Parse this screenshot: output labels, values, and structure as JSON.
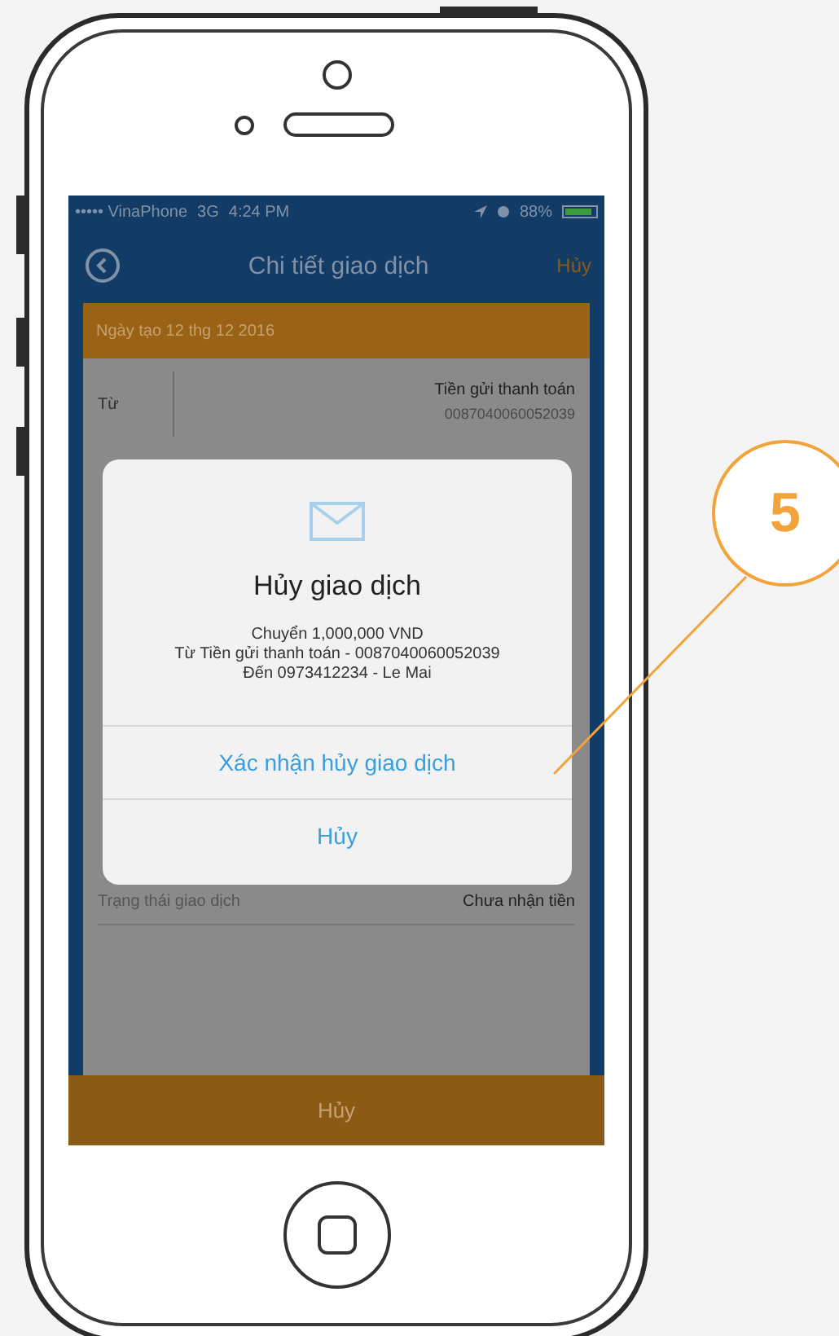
{
  "status_bar": {
    "carrier": "••••• VinaPhone",
    "network": "3G",
    "time": "4:24 PM",
    "battery": "88%"
  },
  "nav_bar": {
    "title": "Chi tiết giao dịch",
    "action": "Hủy"
  },
  "card": {
    "header": "Ngày tạo 12 thg 12 2016",
    "from": {
      "label": "Từ",
      "value": "Tiền gửi thanh toán",
      "account": "0087040060052039"
    },
    "status": {
      "label": "Trạng thái giao dịch",
      "value": "Chưa nhận tiền"
    }
  },
  "dialog": {
    "title": "Hủy giao dịch",
    "message": [
      "Chuyển 1,000,000 VND",
      "Từ Tiền gửi thanh toán - 0087040060052039",
      "Đến 0973412234 - Le Mai"
    ],
    "actions": [
      {
        "label": "Xác nhận hủy giao dịch",
        "kind": "confirm"
      },
      {
        "label": "Hủy",
        "kind": "cancel"
      }
    ]
  },
  "bottom_button": "Hủy",
  "callout": "5"
}
